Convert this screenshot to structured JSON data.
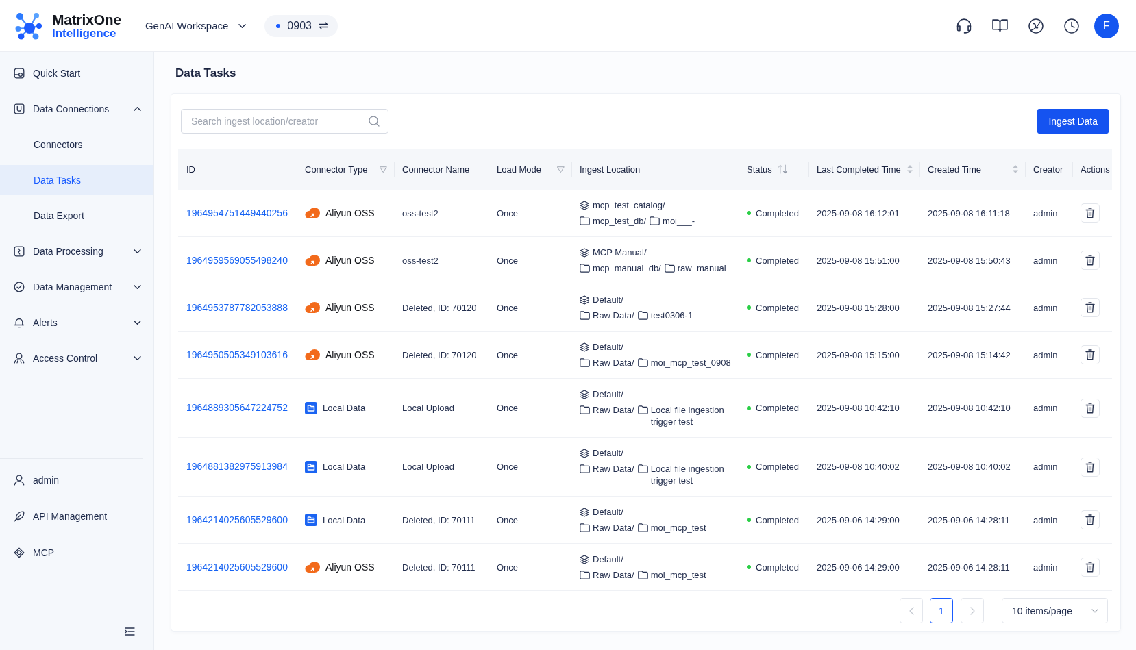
{
  "header": {
    "logo": {
      "name": "MatrixOne",
      "product": "Intelligence"
    },
    "workspace": {
      "label": "GenAI Workspace"
    },
    "instance": {
      "label": "0903"
    },
    "avatar": "F"
  },
  "sidebar": {
    "items": [
      {
        "label": "Quick Start",
        "selected": false
      },
      {
        "label": "Data Connections",
        "selected": false,
        "expanded": true,
        "children": [
          {
            "label": "Connectors",
            "selected": false
          },
          {
            "label": "Data Tasks",
            "selected": true
          },
          {
            "label": "Data Export",
            "selected": false
          }
        ]
      },
      {
        "label": "Data Processing",
        "selected": false,
        "expanded": false
      },
      {
        "label": "Data Management",
        "selected": false,
        "expanded": false
      },
      {
        "label": "Alerts",
        "selected": false,
        "expanded": false
      },
      {
        "label": "Access Control",
        "selected": false,
        "expanded": false
      }
    ],
    "footer_items": [
      {
        "label": "admin",
        "selected": false
      },
      {
        "label": "API Management",
        "selected": false
      },
      {
        "label": "MCP",
        "selected": false
      }
    ]
  },
  "page": {
    "title": "Data Tasks"
  },
  "search": {
    "placeholder": "Search ingest location/creator"
  },
  "ingest_button": {
    "label": "Ingest Data"
  },
  "table": {
    "columns": [
      {
        "label": "ID",
        "kind": "plain"
      },
      {
        "label": "Connector Type",
        "kind": "filter"
      },
      {
        "label": "Connector Name",
        "kind": "plain"
      },
      {
        "label": "Load Mode",
        "kind": "filter"
      },
      {
        "label": "Ingest Location",
        "kind": "plain"
      },
      {
        "label": "Status",
        "kind": "sort_toggle"
      },
      {
        "label": "Last Completed Time",
        "kind": "sort"
      },
      {
        "label": "Created Time",
        "kind": "sort"
      },
      {
        "label": "Creator",
        "kind": "plain"
      },
      {
        "label": "Actions",
        "kind": "plain"
      }
    ],
    "rows": [
      {
        "id": "1964954751449440256",
        "connector_type": {
          "kind": "oss",
          "label": "Aliyun OSS"
        },
        "connector_name": "oss-test2",
        "load_mode": "Once",
        "location": {
          "catalog": "mcp_test_catalog/",
          "folders": [
            "mcp_test_db/",
            "moi___-"
          ]
        },
        "status": {
          "kind": "success",
          "label": "Completed"
        },
        "last_completed": "2025-09-08 16:12:01",
        "created": "2025-09-08 16:11:18",
        "creator": "admin"
      },
      {
        "id": "1964959569055498240",
        "connector_type": {
          "kind": "oss",
          "label": "Aliyun OSS"
        },
        "connector_name": "oss-test2",
        "load_mode": "Once",
        "location": {
          "catalog": "MCP Manual/",
          "folders": [
            "mcp_manual_db/",
            "raw_manual"
          ]
        },
        "status": {
          "kind": "success",
          "label": "Completed"
        },
        "last_completed": "2025-09-08 15:51:00",
        "created": "2025-09-08 15:50:43",
        "creator": "admin"
      },
      {
        "id": "1964953787782053888",
        "connector_type": {
          "kind": "oss",
          "label": "Aliyun OSS"
        },
        "connector_name": "Deleted, ID: 70120",
        "load_mode": "Once",
        "location": {
          "catalog": "Default/",
          "folders": [
            "Raw Data/",
            "test0306-1"
          ]
        },
        "status": {
          "kind": "success",
          "label": "Completed"
        },
        "last_completed": "2025-09-08 15:28:00",
        "created": "2025-09-08 15:27:44",
        "creator": "admin"
      },
      {
        "id": "1964950505349103616",
        "connector_type": {
          "kind": "oss",
          "label": "Aliyun OSS"
        },
        "connector_name": "Deleted, ID: 70120",
        "load_mode": "Once",
        "location": {
          "catalog": "Default/",
          "folders": [
            "Raw Data/",
            "moi_mcp_test_0908"
          ]
        },
        "status": {
          "kind": "success",
          "label": "Completed"
        },
        "last_completed": "2025-09-08 15:15:00",
        "created": "2025-09-08 15:14:42",
        "creator": "admin"
      },
      {
        "id": "1964889305647224752",
        "connector_type": {
          "kind": "local",
          "label": "Local Data"
        },
        "connector_name": "Local Upload",
        "load_mode": "Once",
        "location": {
          "catalog": "Default/",
          "folders": [
            "Raw Data/",
            "Local file ingestion trigger test"
          ]
        },
        "status": {
          "kind": "success",
          "label": "Completed"
        },
        "last_completed": "2025-09-08 10:42:10",
        "created": "2025-09-08 10:42:10",
        "creator": "admin"
      },
      {
        "id": "1964881382975913984",
        "connector_type": {
          "kind": "local",
          "label": "Local Data"
        },
        "connector_name": "Local Upload",
        "load_mode": "Once",
        "location": {
          "catalog": "Default/",
          "folders": [
            "Raw Data/",
            "Local file ingestion trigger test"
          ]
        },
        "status": {
          "kind": "success",
          "label": "Completed"
        },
        "last_completed": "2025-09-08 10:40:02",
        "created": "2025-09-08 10:40:02",
        "creator": "admin"
      },
      {
        "id": "1964214025605529600",
        "connector_type": {
          "kind": "local",
          "label": "Local Data"
        },
        "connector_name": "Deleted, ID: 70111",
        "load_mode": "Once",
        "location": {
          "catalog": "Default/",
          "folders": [
            "Raw Data/",
            "moi_mcp_test"
          ]
        },
        "status": {
          "kind": "success",
          "label": "Completed"
        },
        "last_completed": "2025-09-06 14:29:00",
        "created": "2025-09-06 14:28:11",
        "creator": "admin"
      },
      {
        "id": "1964214025605529600",
        "connector_type": {
          "kind": "oss",
          "label": "Aliyun OSS"
        },
        "connector_name": "Deleted, ID: 70111",
        "load_mode": "Once",
        "location": {
          "catalog": "Default/",
          "folders": [
            "Raw Data/",
            "moi_mcp_test"
          ]
        },
        "status": {
          "kind": "success",
          "label": "Completed"
        },
        "last_completed": "2025-09-06 14:29:00",
        "created": "2025-09-06 14:28:11",
        "creator": "admin"
      }
    ]
  },
  "pagination": {
    "previous": {
      "disabled": true
    },
    "pages": [
      {
        "label": "1",
        "selected": true
      }
    ],
    "next": {
      "disabled": true
    },
    "page_size": "10 items/page"
  }
}
